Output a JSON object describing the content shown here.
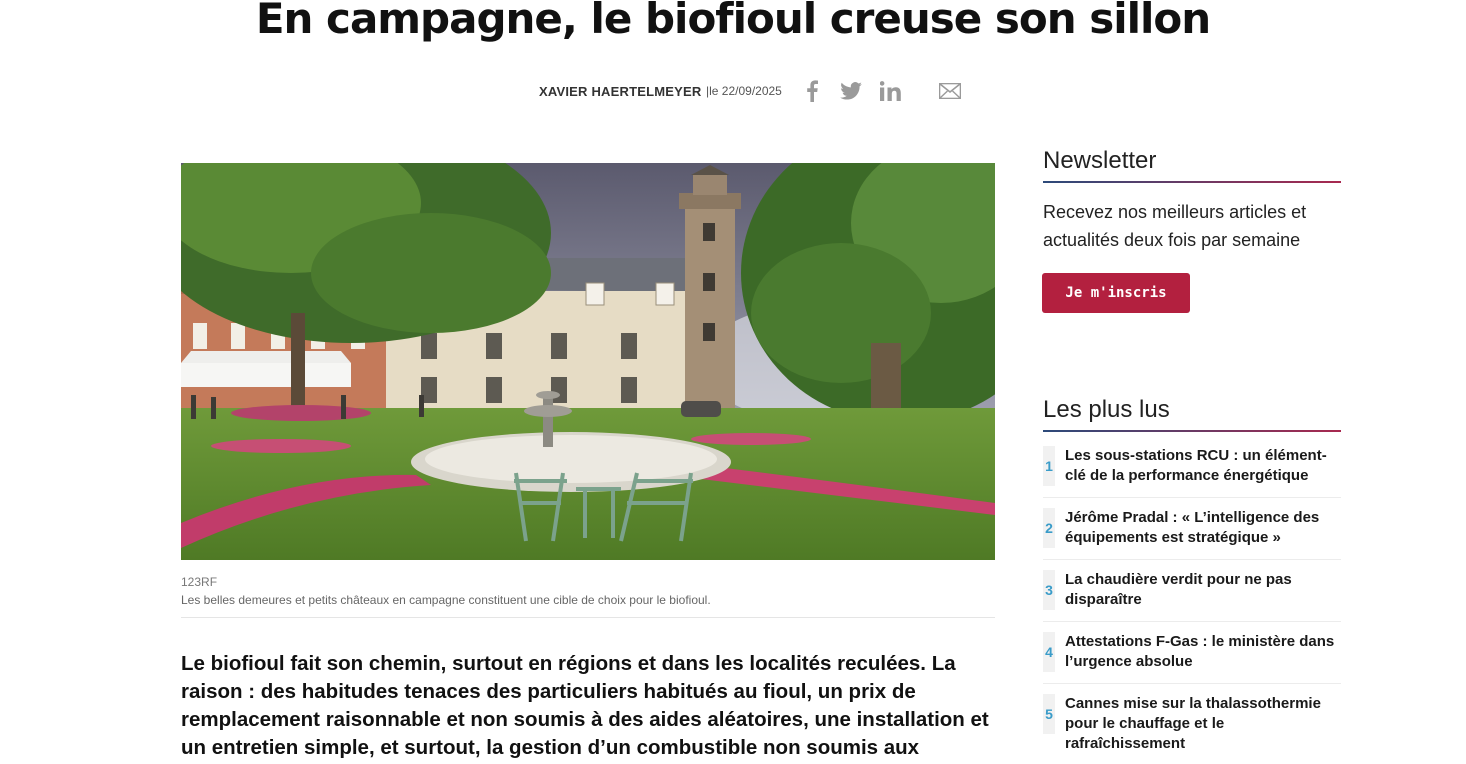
{
  "article": {
    "title": "En campagne, le biofioul creuse son sillon",
    "author": "XAVIER HAERTELMEYER",
    "date": "|le 22/09/2025",
    "share_icons": [
      "facebook-icon",
      "twitter-icon",
      "linkedin-icon",
      "email-icon"
    ],
    "image_credit": "123RF",
    "image_caption": "Les belles demeures et petits châteaux en campagne constituent une cible de choix pour le biofioul.",
    "lead": "Le biofioul fait son chemin, surtout en régions et dans les localités reculées. La raison : des habitudes tenaces des particuliers habitués au fioul, un prix de remplacement raisonnable et non soumis à des aides aléatoires, une installation et un entretien simple, et surtout, la gestion d’un combustible non soumis aux"
  },
  "sidebar": {
    "newsletter": {
      "title": "Newsletter",
      "text": "Recevez nos meilleurs articles et actualités deux fois par semaine",
      "button_label": "Je m'inscris"
    },
    "most_read": {
      "title": "Les plus lus",
      "items": [
        {
          "num": "1",
          "label": "Les sous-stations RCU : un élément-clé de la performance énergétique"
        },
        {
          "num": "2",
          "label": "Jérôme Pradal : « L’intelligence des équipements est stratégique »"
        },
        {
          "num": "3",
          "label": "La chaudière verdit pour ne pas disparaître"
        },
        {
          "num": "4",
          "label": "Attestations F-Gas : le ministère dans l’urgence absolue"
        },
        {
          "num": "5",
          "label": "Cannes mise sur la thalassothermie pour le chauffage et le rafraîchissement"
        }
      ]
    }
  },
  "colors": {
    "accent_button": "#b3203f",
    "rank_number": "#3a9cc9",
    "divider_gradient_start": "#2c4a7a",
    "divider_gradient_end": "#a8294f"
  }
}
